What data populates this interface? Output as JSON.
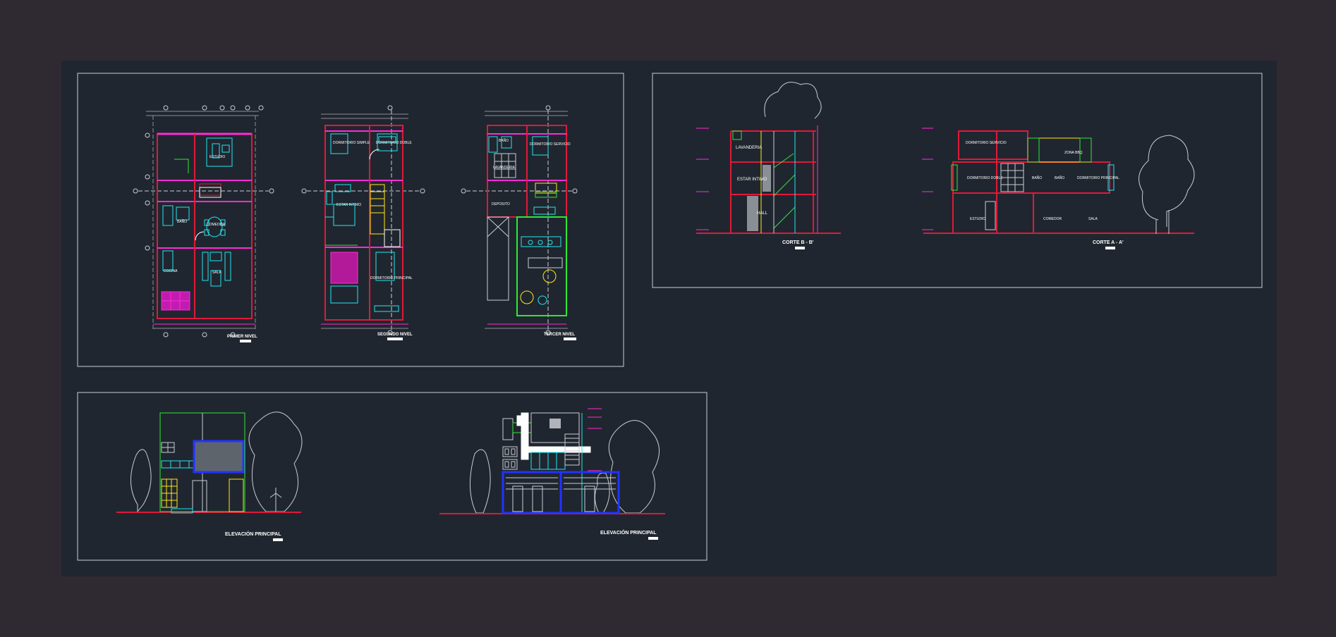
{
  "colors": {
    "background": "#2f2a32",
    "model_space": "#20262f",
    "frame": "#c8ccd4",
    "wall": "#e0193a",
    "magenta": "#ff2bd6",
    "cyan": "#22e6f0",
    "green": "#2ee836",
    "yellow": "#ffe81a",
    "blue": "#2233ff",
    "white": "#ffffff",
    "grey": "#8a8f96"
  },
  "plans": {
    "primer_nivel": {
      "title": "PRIMER NIVEL",
      "rooms": {
        "estudio": "ESTUDIO",
        "comedor": "COMEDOR",
        "sala": "SALA",
        "cocina": "COCINA",
        "bano": "BAÑO"
      }
    },
    "segundo_nivel": {
      "title": "SEGUNDO NIVEL",
      "rooms": {
        "dormitorio_simple": "DORMITORIO SIMPLE",
        "dormitorio_doble": "DORMITORIO DOBLE",
        "estar_intimo": "ESTAR INTIMO",
        "dormitorio_principal": "DORMITORIO PRINCIPAL"
      }
    },
    "tercer_nivel": {
      "title": "TERCER NIVEL",
      "rooms": {
        "bano": "BAÑO",
        "dormitorio_servicio": "DORMITORIO SERVICIO",
        "lavanderia": "LAVANDERIA",
        "deposito": "DEPOSITO"
      }
    }
  },
  "sections": {
    "corte_b": {
      "title": "CORTE B - B'",
      "rooms": {
        "lavanderia": "LAVANDERIA",
        "estar_intimo": "ESTAR INTIMO",
        "hall": "HALL"
      }
    },
    "corte_a": {
      "title": "CORTE A - A'",
      "rooms": {
        "dormitorio_servicio": "DORMITORIO SERVICIO",
        "zona_bbq": "ZONA BBQ",
        "dormitorio_doble": "DORMITORIO DOBLE",
        "bano1": "BAÑO",
        "bano2": "BAÑO",
        "dormitorio_principal": "DORMITORIO PRINCIPAL",
        "estudio": "ESTUDIO",
        "comedor": "COMEDOR",
        "sala": "SALA"
      }
    }
  },
  "elevations": {
    "front": {
      "title": "ELEVACIÓN PRINCIPAL"
    },
    "side": {
      "title": "ELEVACIÓN PRINCIPAL"
    }
  }
}
